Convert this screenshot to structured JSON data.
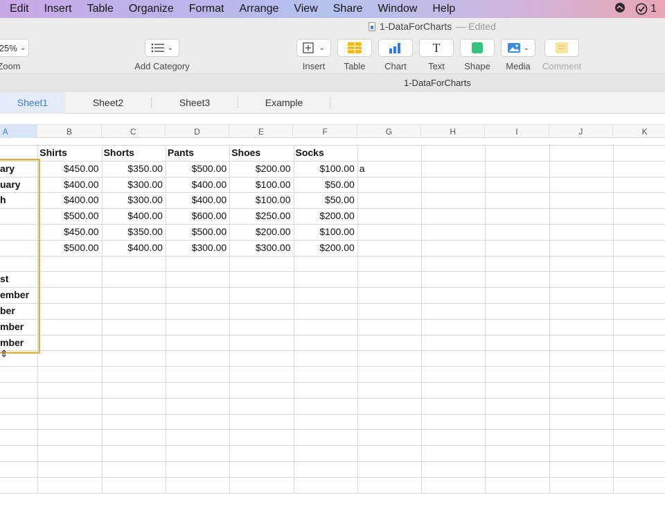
{
  "menubar": {
    "items": [
      "Edit",
      "Insert",
      "Table",
      "Organize",
      "Format",
      "Arrange",
      "View",
      "Share",
      "Window",
      "Help"
    ],
    "badge_count": "1"
  },
  "toolbar": {
    "doc_title": "1-DataForCharts",
    "doc_status": "— Edited",
    "zoom_value": "25%",
    "zoom_label": "Zoom",
    "add_category_label": "Add Category",
    "insert_label": "Insert",
    "table_label": "Table",
    "chart_label": "Chart",
    "text_label": "Text",
    "shape_label": "Shape",
    "media_label": "Media",
    "comment_label": "Comment",
    "text_glyph": "T"
  },
  "subtitle": "1-DataForCharts",
  "tabs": [
    "Sheet1",
    "Sheet2",
    "Sheet3",
    "Example"
  ],
  "columns": [
    "A",
    "B",
    "C",
    "D",
    "E",
    "F",
    "G",
    "H",
    "I",
    "J",
    "K"
  ],
  "table": {
    "headers": [
      "Shirts",
      "Shorts",
      "Pants",
      "Shoes",
      "Socks"
    ],
    "rows": [
      {
        "month": "ary",
        "values": [
          "$450.00",
          "$350.00",
          "$500.00",
          "$200.00",
          "$100.00"
        ]
      },
      {
        "month": "uary",
        "values": [
          "$400.00",
          "$300.00",
          "$400.00",
          "$100.00",
          "$50.00"
        ]
      },
      {
        "month": "h",
        "values": [
          "$400.00",
          "$300.00",
          "$400.00",
          "$100.00",
          "$50.00"
        ]
      },
      {
        "month": "",
        "values": [
          "$500.00",
          "$400.00",
          "$600.00",
          "$250.00",
          "$200.00"
        ]
      },
      {
        "month": "",
        "values": [
          "$450.00",
          "$350.00",
          "$500.00",
          "$200.00",
          "$100.00"
        ]
      },
      {
        "month": "",
        "values": [
          "$500.00",
          "$400.00",
          "$300.00",
          "$300.00",
          "$200.00"
        ]
      },
      {
        "month": "",
        "values": [
          "",
          "",
          "",
          "",
          ""
        ]
      },
      {
        "month": "st",
        "values": [
          "",
          "",
          "",
          "",
          ""
        ]
      },
      {
        "month": "ember",
        "values": [
          "",
          "",
          "",
          "",
          ""
        ]
      },
      {
        "month": "ber",
        "values": [
          "",
          "",
          "",
          "",
          ""
        ]
      },
      {
        "month": "mber",
        "values": [
          "",
          "",
          "",
          "",
          ""
        ]
      },
      {
        "month": "mber",
        "values": [
          "",
          "",
          "",
          "",
          ""
        ]
      }
    ],
    "extra_cell_g2": "a"
  }
}
